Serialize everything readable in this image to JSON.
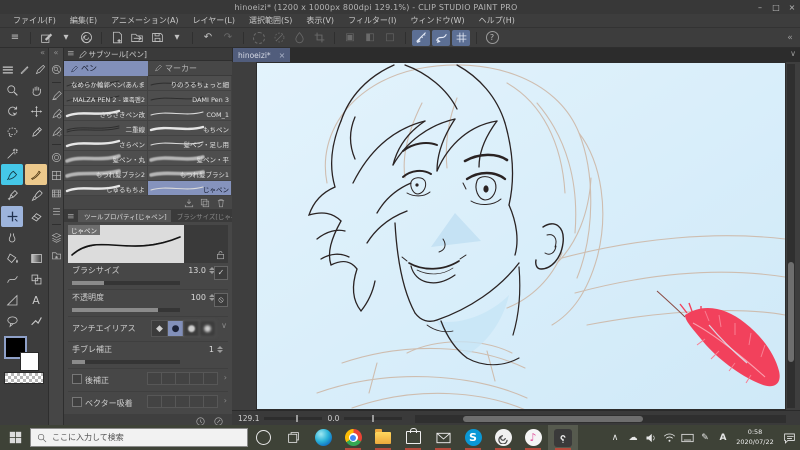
{
  "title_bar": {
    "title": "hinoeizi* (1200 x 1000px 800dpi 129.1%)  - CLIP STUDIO PAINT PRO",
    "minimize": "–",
    "maximize": "□",
    "close": "×"
  },
  "menu_bar": {
    "items": [
      "ファイル(F)",
      "編集(E)",
      "アニメーション(A)",
      "レイヤー(L)",
      "選択範囲(S)",
      "表示(V)",
      "フィルター(I)",
      "ウィンドウ(W)",
      "ヘルプ(H)"
    ]
  },
  "command_bar": {
    "collapse_left": "«",
    "collapse_right": "«"
  },
  "document": {
    "tab_label": "hinoeizi*",
    "tab_close": "×",
    "strip_chevron": "∨"
  },
  "subtool_panel": {
    "menu_glyph": "≡",
    "title": "サブツール[ペン]",
    "tab_pen": "ペン",
    "tab_marker": "マーカー",
    "brushes": [
      {
        "l": "なめらか輪郭ペン(あんま",
        "r": "りのうるちょっと細"
      },
      {
        "l": "MALZA PEN 2 - 뾰족펜2",
        "r": "DAMI Pen 3"
      },
      {
        "l": "さらさきペン改",
        "r": "COM_1"
      },
      {
        "l": "二重線",
        "r": "もちペン"
      },
      {
        "l": "さらペン",
        "r": "髪ペン・足し用"
      },
      {
        "l": "髪ペン・丸",
        "r": "髪ペン・平"
      },
      {
        "l": "もつれ髪ブラシ2",
        "r": "もつれ髪ブラシ1"
      },
      {
        "l": "しゅるもちよ",
        "r": "じゃペン"
      }
    ]
  },
  "tool_property": {
    "menu_glyph": "≡",
    "tab_active": "ツールプロパティ[じゃペン]",
    "tab_inactive": "ブラシサイズ[じゃペン]",
    "brush_chip": "じゃペン",
    "size_label": "ブラシサイズ",
    "size_value": "13.0",
    "opacity_label": "不透明度",
    "opacity_value": "100",
    "aa_label": "アンチエイリアス",
    "stabilize_label": "手ブレ補正",
    "stabilize_value": "1",
    "post_correction_label": "後補正",
    "vector_snap_label": "ベクター吸着"
  },
  "status_bar": {
    "zoom": "129.1",
    "rotation": "0.0"
  },
  "canvas": {
    "colors": {
      "background": "#d8edf9",
      "sketch_line": "#cdb5a3",
      "ink_line": "#2a2323",
      "feather_red": "#f2415c",
      "selection_accent": "#8290ba",
      "active_tool_cyan": "#45c8e8"
    }
  },
  "taskbar": {
    "search_placeholder": "ここに入力して検索",
    "ime_indicator": "A",
    "clock_time": "0:58",
    "clock_date": "2020/07/22",
    "tray_chevron": "∧"
  }
}
